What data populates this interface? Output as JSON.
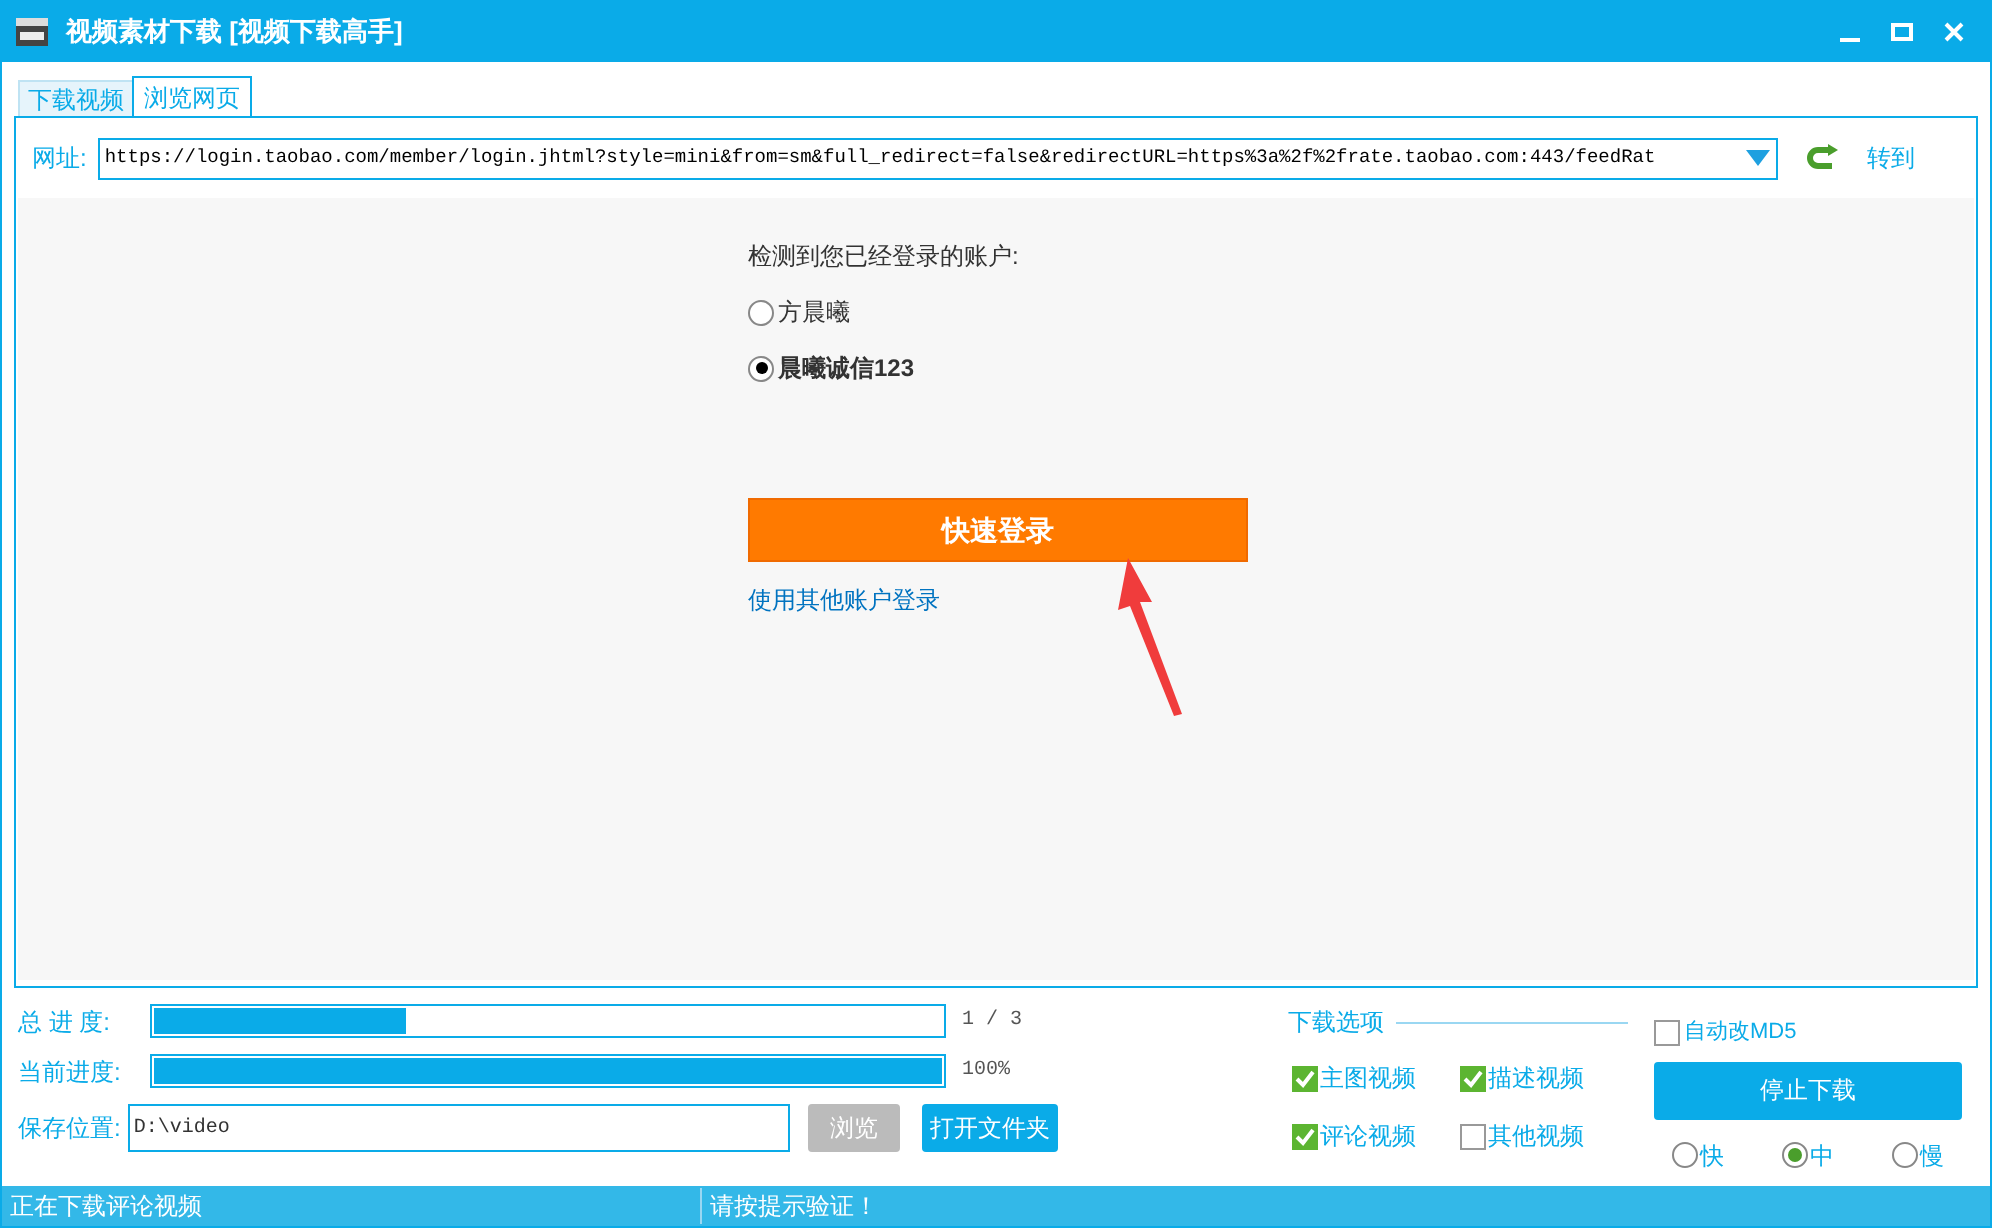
{
  "window": {
    "title": "视频素材下载 [视频下载高手]"
  },
  "tabs": [
    {
      "label": "下载视频",
      "selected": false
    },
    {
      "label": "浏览网页",
      "selected": true
    }
  ],
  "address": {
    "label": "网址:",
    "value": "https://login.taobao.com/member/login.jhtml?style=mini&from=sm&full_redirect=false&redirectURL=https%3a%2f%2frate.taobao.com:443/feedRat",
    "go": "转到"
  },
  "page": {
    "prompt": "检测到您已经登录的账户:",
    "accounts": [
      {
        "name": "方晨曦",
        "selected": false
      },
      {
        "name": "晨曦诚信123",
        "selected": true
      }
    ],
    "login_button": "快速登录",
    "other_login": "使用其他账户登录"
  },
  "progress": [
    {
      "label": "总 进 度:",
      "level": 0.32,
      "reading": "1 / 3"
    },
    {
      "label": "当前进度:",
      "level": 1,
      "reading": "100%"
    }
  ],
  "save": {
    "label": "保存位置:",
    "value": "D:\\video",
    "browse": "浏览",
    "browse_disabled": true,
    "open_folder": "打开文件夹"
  },
  "options": {
    "title": "下载选项",
    "items": [
      {
        "label": "主图视频",
        "checked": true
      },
      {
        "label": "描述视频",
        "checked": true
      },
      {
        "label": "评论视频",
        "checked": true
      },
      {
        "label": "其他视频",
        "checked": false
      }
    ]
  },
  "auto_md5": {
    "label": "自动改MD5",
    "checked": false
  },
  "stop_button": "停止下载",
  "speeds": [
    {
      "label": "快",
      "selected": false
    },
    {
      "label": "中",
      "selected": true
    },
    {
      "label": "慢",
      "selected": false
    }
  ],
  "status_bar": [
    "正在下载评论视频",
    "请按提示验证！"
  ]
}
